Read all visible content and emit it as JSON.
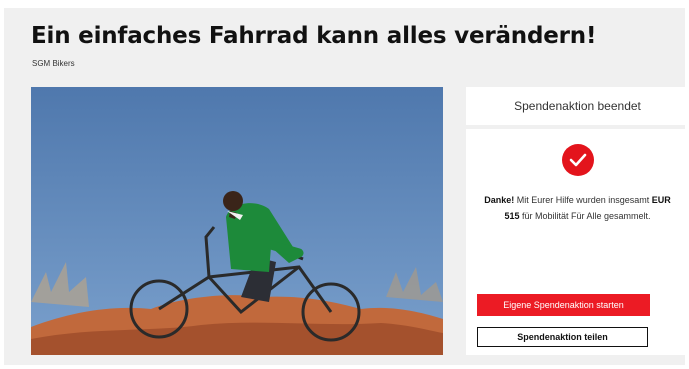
{
  "campaign": {
    "title": "Ein einfaches Fahrrad kann alles verändern!",
    "organizer": "SGM Bikers"
  },
  "status_panel": {
    "heading": "Spendenaktion beendet",
    "thanks_bold": "Danke!",
    "thanks_text_1": " Mit Eurer Hilfe wurden insgesamt ",
    "amount": "EUR 515",
    "thanks_text_2": " für Mobilität Für Alle gesammelt.",
    "check_icon": "check-icon"
  },
  "actions": {
    "start_label": "Eigene Spendenaktion starten",
    "share_label": "Spendenaktion teilen"
  },
  "colors": {
    "accent_red": "#ec1b24",
    "background": "#f0f0f0"
  }
}
